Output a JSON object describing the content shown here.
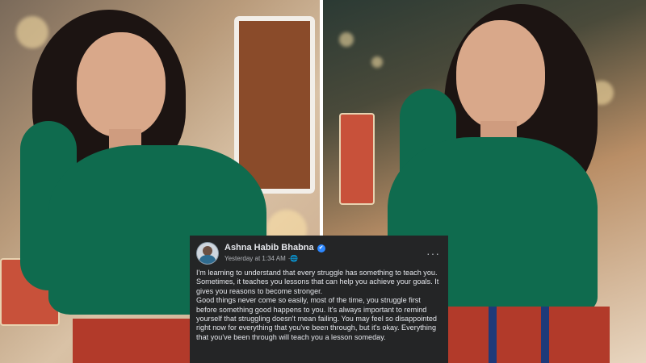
{
  "post": {
    "author": "Ashna Habib Bhabna",
    "time": "Yesterday at 1:34 AM",
    "privacy_icon": "globe-icon",
    "verified_icon": "verified-badge-icon",
    "more_icon": "more-options-icon",
    "more_glyph": "···",
    "paragraphs": [
      "I'm learning to understand that every struggle has something to teach you. Sometimes, it teaches you lessons that can help you achieve your goals. It gives you reasons to become stronger.",
      "Good things never come so easily, most of the time, you struggle first before something good happens to you. It's always important to remind yourself that struggling doesn't mean failing. You may feel so disappointed right now for everything that you've been through, but it's okay. Everything that you've been through will teach you a lesson someday."
    ]
  },
  "colors": {
    "card_bg": "#242526",
    "text_primary": "#e4e6eb",
    "text_secondary": "#b0b3b8",
    "verified": "#2d88ff",
    "top_green": "#0f6b4e"
  }
}
